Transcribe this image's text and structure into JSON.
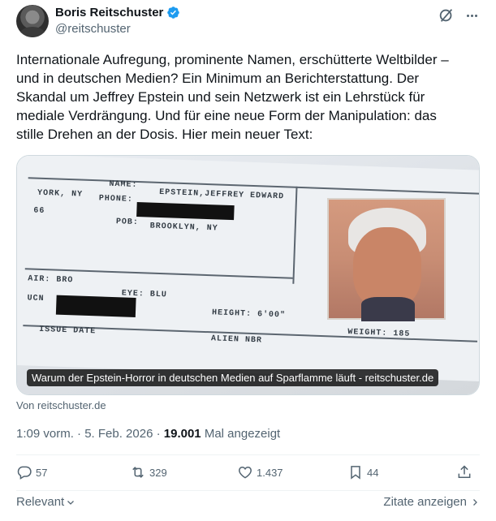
{
  "author": {
    "display_name": "Boris Reitschuster",
    "handle": "@reitschuster"
  },
  "tweet": {
    "text": "Internationale Aufregung, prominente Namen, erschütterte Weltbilder –\nund in deutschen Medien? Ein Minimum an Berichterstattung. Der\nSkandal um Jeffrey Epstein und sein Netzwerk ist ein Lehrstück für\nmediale Verdrängung. Und für eine neue Form der Manipulation: das\nstille Drehen an der Dosis. Hier mein neuer Text:"
  },
  "media": {
    "caption": "Warum der Epstein-Horror in deutschen Medien auf Sparflamme läuft - reitschuster.de",
    "form": {
      "york": "YORK, NY",
      "name_label": "NAME:",
      "name_value": "EPSTEIN,JEFFREY EDWARD",
      "phone_label": "PHONE:",
      "num": "66",
      "pob_label": "POB:",
      "pob_value": "BROOKLYN, NY",
      "hair": "AIR: BRO",
      "eye": "EYE: BLU",
      "ucn": "UCN",
      "height": "HEIGHT: 6'00\"",
      "weight": "WEIGHT: 185",
      "issue": "ISSUE DATE",
      "alien": "ALIEN NBR"
    }
  },
  "source_label": "Von reitschuster.de",
  "meta": {
    "time_date": "1:09 vorm. · 5. Feb. 2026 · ",
    "views": "19.001",
    "views_label": " Mal angezeigt"
  },
  "actions": {
    "replies": "57",
    "reposts": "329",
    "likes": "1.437",
    "bookmarks": "44"
  },
  "footer": {
    "relevant": "Relevant",
    "quotes": "Zitate anzeigen"
  },
  "colors": {
    "verified": "#1d9bf0",
    "secondary_text": "#536471",
    "primary_text": "#0f1419"
  }
}
